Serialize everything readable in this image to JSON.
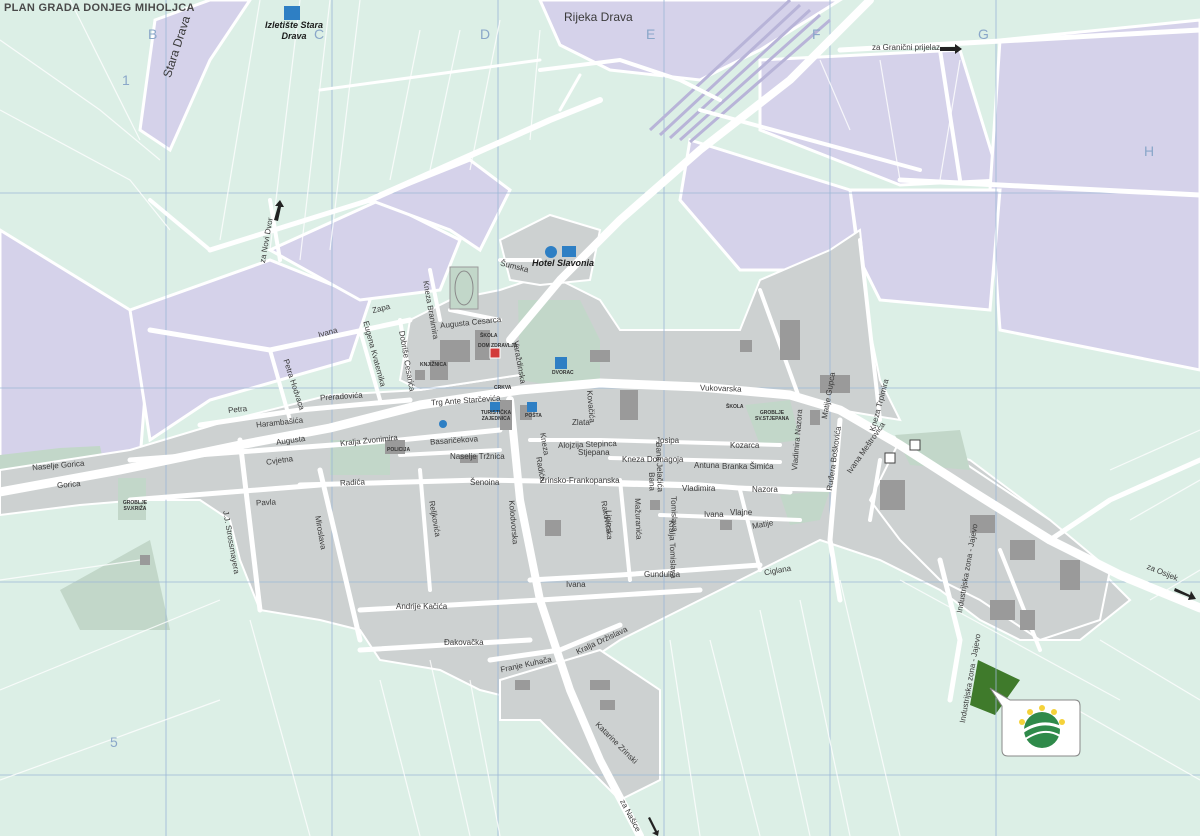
{
  "map": {
    "title": "PLAN GRADA DONJEG MIHOLJCA",
    "grid_columns": [
      "B",
      "C",
      "D",
      "E",
      "F",
      "G",
      "H"
    ],
    "grid_rows": [
      "1",
      "5"
    ],
    "water": {
      "river": "Rijeka Drava",
      "oxbow": "Stara Drava"
    },
    "pois": {
      "excursion": "Izletište Stara Drava",
      "hotel": "Hotel Slavonia",
      "tourist_office": "TURISTIČKA ZAJEDNICA",
      "post": "POŠTA",
      "school1": "ŠKOLA",
      "school2": "ŠKOLA",
      "health": "DOM ZDRAVLJA",
      "police": "POLICIJA",
      "cemetery1": "GROBLJE SV.STJEPANA",
      "cemetery2": "GROBLJE SV.KRIŽA",
      "library": "KNJIŽNICA",
      "church": "CRKVA",
      "castle": "DVORAC"
    },
    "directions": {
      "border": "za Granični prijelaz",
      "osijek": "za Osijek",
      "bridge": "za Novi Dvor",
      "south": "za Našice"
    },
    "streets": {
      "vukovarska": "Vukovarska",
      "petra_preradovica": "Preradovića",
      "petra": "Petra",
      "harambasica": "Harambašića",
      "augusta": "Augusta",
      "trg": "Trg Ante Starčevića",
      "basaricekova": "Basaričekova",
      "naselje_gorica": "Naselje Gorica",
      "gorica": "Gorica",
      "kralja_zvonimira": "Kralja Zvonimira",
      "naselje_trznica": "Naselje Tržnica",
      "senoina": "Šenoina",
      "radica": "Radića",
      "pavla": "Pavla",
      "zrinsko": "Zrinsko-Frankopanska",
      "alojzija": "Alojzija Stepinca",
      "josipa": "Josipa",
      "kozarca": "Kozarca",
      "kneza_domagoja": "Kneza Domagoja",
      "antuna": "Antuna",
      "branka_simica": "Branka Šimića",
      "vladimira": "Vladimira",
      "nazora": "Nazora",
      "ivana": "Ivana",
      "gunduliča": "Gundulića",
      "andrije_kacica": "Andrije Kačića",
      "dacovacka": "Đakovačka",
      "franje_kuhaca": "Franje Kuhača",
      "kralja_drzislava": "Kralja Držislava",
      "ciglana": "Ciglana",
      "matije": "Matije",
      "vlajne": "Vlajne",
      "zlata": "Zlata",
      "ivana2": "Ivana",
      "kolodvorska": "Kolodvorska",
      "lipinska": "Lipinska",
      "bana": "Bana",
      "reljkovica": "Reljkovića",
      "iyana_mestrovica": "Ivana Meštrovića",
      "rudera_boskovica": "Ruđera Boškovića",
      "kneza_trpimira": "Kneza Trpimira",
      "matije_gupca": "Matije Gupca",
      "vladimira_nazora": "Vladimira Nazora",
      "jelacica": "Bana Jelačića",
      "stossmayera": "J.J. Strossmayera",
      "miroslava": "Miroslava",
      "tomislava": "Tomislava",
      "mazuranica": "Mažuranića",
      "kralja_tomislava": "Kralja Tomislava",
      "sumska": "Šumska",
      "augusta_cesarca": "Augusta Cesarca",
      "kneza_branimira": "Kneza Branimira",
      "dobrise_cesarica": "Dobriše Cesarića",
      "eugena_kvaternika": "Eugena Kvaternika",
      "zapa": "Zapa",
      "ivana_basic": "Ivana",
      "petra_hodvaca": "Petra Hodvaca",
      "cvjetna": "Cvjetna",
      "katarine_zrinski": "Katarine Zrinski",
      "industrijska": "Industrijska zona - Jajevo",
      "industrijska2": "Industrijska zona - Jajevo",
      "kovacica": "Kovačića",
      "stjepana": "Stjepana",
      "kneza": "Kneza",
      "radica2": "Radića",
      "racica": "Rakovica",
      "varisko": "Varaždinska"
    },
    "colors": {
      "meadow": "#dcefe6",
      "forest": "#d5d2ea",
      "urban": "#cdd1d1",
      "road": "#ffffff",
      "park": "#c2d7c9",
      "building": "#9a9a9a",
      "industry_green": "#3f7a2b",
      "grid_line": "#9bb7d6"
    }
  }
}
